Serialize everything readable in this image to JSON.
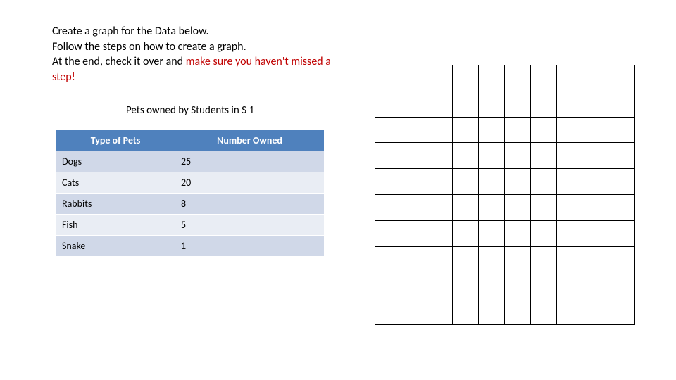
{
  "instructions": {
    "line1": "Create a graph for the Data below.",
    "line2": "Follow the steps on how to create a graph.",
    "line3a": "At the end, check it over and ",
    "line3b_warn": "make sure you haven't missed a step!"
  },
  "caption": "Pets owned by Students in S 1",
  "table": {
    "headers": {
      "col1": "Type of Pets",
      "col2": "Number Owned"
    },
    "rows": [
      {
        "pet": "Dogs",
        "count": "25"
      },
      {
        "pet": "Cats",
        "count": "20"
      },
      {
        "pet": "Rabbits",
        "count": "8"
      },
      {
        "pet": "Fish",
        "count": "5"
      },
      {
        "pet": "Snake",
        "count": "1"
      }
    ]
  },
  "grid": {
    "rows": 10,
    "cols": 10
  },
  "chart_data": {
    "type": "table",
    "title": "Pets owned by Students in S 1",
    "columns": [
      "Type of Pets",
      "Number Owned"
    ],
    "rows": [
      [
        "Dogs",
        25
      ],
      [
        "Cats",
        20
      ],
      [
        "Rabbits",
        8
      ],
      [
        "Fish",
        5
      ],
      [
        "Snake",
        1
      ]
    ]
  }
}
